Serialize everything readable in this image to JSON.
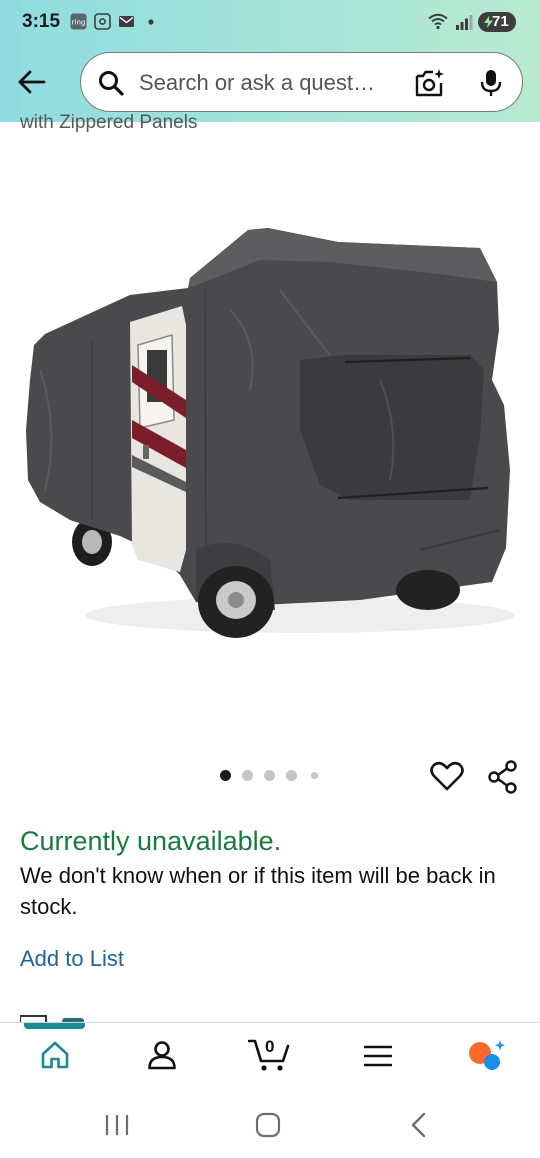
{
  "status_bar": {
    "time": "3:15",
    "notification_icons": [
      "ring-icon",
      "screenshot-icon",
      "mail-icon",
      "dot-icon"
    ],
    "battery": "71"
  },
  "search": {
    "placeholder": "Search or ask a quest…"
  },
  "product": {
    "title_fragment": "with Zippered Panels",
    "image_count": 5,
    "active_image_index": 0
  },
  "availability": {
    "status": "Currently unavailable.",
    "message": "We don't know when or if this item will be back in stock."
  },
  "actions": {
    "add_to_list": "Add to List"
  },
  "bottom_nav": {
    "items": [
      "home-icon",
      "account-icon",
      "cart-icon",
      "menu-icon",
      "rufus-icon"
    ],
    "cart_count": "0",
    "active": "home",
    "accent_color": "#1a8a96"
  },
  "colors": {
    "availability_green": "#187b3e",
    "link_blue": "#2162a1",
    "header_gradient_start": "#8fdce0",
    "header_gradient_end": "#b9ead2"
  }
}
